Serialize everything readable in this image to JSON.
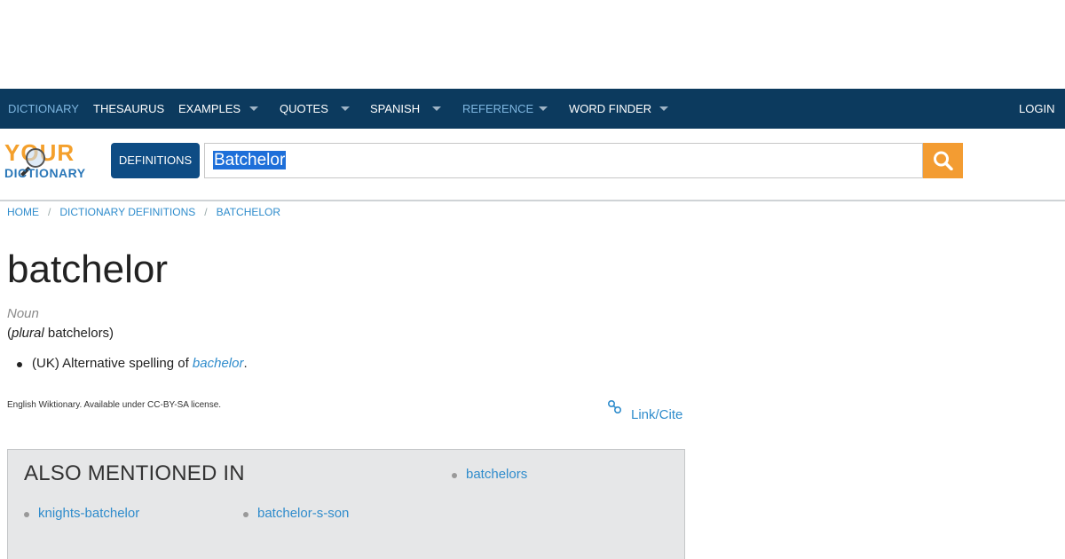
{
  "nav": {
    "items": [
      {
        "label": "DICTIONARY",
        "active": true,
        "has_caret": false
      },
      {
        "label": "THESAURUS",
        "active": false,
        "has_caret": false
      },
      {
        "label": "EXAMPLES",
        "active": false,
        "has_caret": true
      },
      {
        "label": "QUOTES",
        "active": false,
        "has_caret": true
      },
      {
        "label": "SPANISH",
        "active": false,
        "has_caret": true
      },
      {
        "label": "REFERENCE",
        "active": true,
        "has_caret": true
      },
      {
        "label": "WORD FINDER",
        "active": false,
        "has_caret": true
      }
    ],
    "login": "LOGIN"
  },
  "header": {
    "logo_line1": "YOUR",
    "logo_line2": "DICTIONARY",
    "definitions_button": "DEFINITIONS",
    "search_value": "Batchelor",
    "search_icon": "search-icon"
  },
  "breadcrumb": {
    "home": "HOME",
    "section": "DICTIONARY DEFINITIONS",
    "current": "BATCHELOR"
  },
  "entry": {
    "word": "batchelor",
    "part_of_speech": "Noun",
    "plural_open": "(",
    "plural_label": "plural",
    "plural_value": " batchelors)",
    "definition_prefix": "(UK) Alternative spelling of ",
    "definition_link": "bachelor",
    "definition_suffix": ".",
    "license": "English Wiktionary. Available under CC-BY-SA license.",
    "link_cite": "Link/Cite"
  },
  "also_mentioned": {
    "heading": "ALSO MENTIONED IN",
    "items": [
      "batchelors",
      "knights-batchelor",
      "batchelor-s-son"
    ]
  },
  "colors": {
    "nav_bg": "#0c3a5e",
    "accent_orange": "#f39c32",
    "button_blue": "#0e4c84",
    "link_blue": "#2f8ccc"
  }
}
